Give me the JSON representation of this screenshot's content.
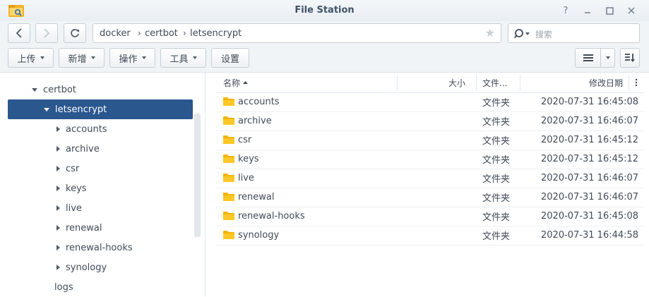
{
  "window": {
    "title": "File Station"
  },
  "pathbar": {
    "crumbs": [
      "docker",
      "certbot",
      "letsencrypt"
    ]
  },
  "search": {
    "placeholder": "搜索"
  },
  "toolbar": {
    "upload": "上传",
    "new": "新增",
    "action": "操作",
    "tools": "工具",
    "settings": "设置"
  },
  "tree": {
    "parent": "certbot",
    "selected": "letsencrypt",
    "children": [
      "accounts",
      "archive",
      "csr",
      "keys",
      "live",
      "renewal",
      "renewal-hooks",
      "synology"
    ],
    "sibling": "logs"
  },
  "columns": {
    "name": "名称",
    "size": "大小",
    "type": "文件...",
    "modified": "修改日期"
  },
  "files": [
    {
      "name": "accounts",
      "type": "文件夹",
      "modified": "2020-07-31 16:45:08"
    },
    {
      "name": "archive",
      "type": "文件夹",
      "modified": "2020-07-31 16:46:07"
    },
    {
      "name": "csr",
      "type": "文件夹",
      "modified": "2020-07-31 16:45:12"
    },
    {
      "name": "keys",
      "type": "文件夹",
      "modified": "2020-07-31 16:45:12"
    },
    {
      "name": "live",
      "type": "文件夹",
      "modified": "2020-07-31 16:46:07"
    },
    {
      "name": "renewal",
      "type": "文件夹",
      "modified": "2020-07-31 16:46:07"
    },
    {
      "name": "renewal-hooks",
      "type": "文件夹",
      "modified": "2020-07-31 16:45:08"
    },
    {
      "name": "synology",
      "type": "文件夹",
      "modified": "2020-07-31 16:44:58"
    }
  ],
  "colors": {
    "selection": "#2a578e",
    "folder": "#f5b400",
    "title": "#3f5267"
  },
  "icons": [
    "file-station-app-icon",
    "help-icon",
    "minimize-icon",
    "maximize-icon",
    "close-icon",
    "back-icon",
    "forward-icon",
    "refresh-icon",
    "star-icon",
    "search-icon",
    "list-view-icon",
    "sort-icon",
    "folder-icon",
    "column-menu-icon"
  ]
}
